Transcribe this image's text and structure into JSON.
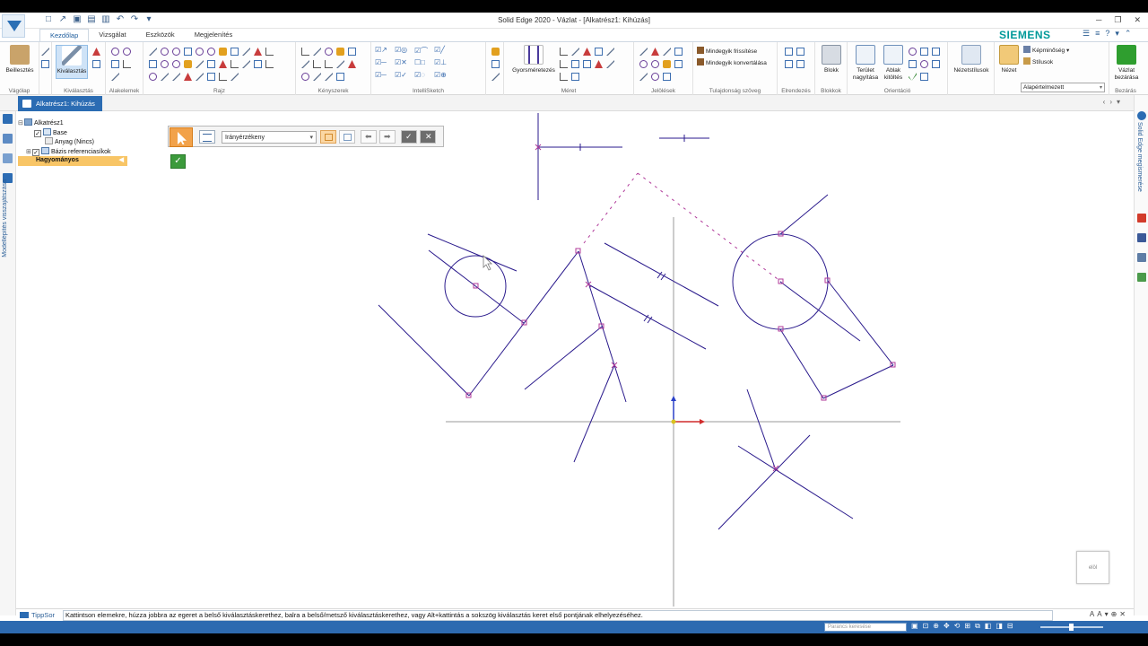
{
  "window": {
    "title": "Solid Edge 2020 - Vázlat - [Alkatrész1: Kihúzás]",
    "brand": "SIEMENS"
  },
  "ribbon_tabs": [
    "Kezdőlap",
    "Vizsgálat",
    "Eszközök",
    "Megjelenítés"
  ],
  "ribbon": {
    "clipboard": {
      "button": "Beillesztés",
      "group": "Vágólap"
    },
    "select": {
      "button": "Kiválasztás",
      "group": "Kiválasztás"
    },
    "features_group": "Alakelemek",
    "draw_group": "Rajz",
    "relations_group": "Kényszerek",
    "intellisketch_group": "IntelliSketch",
    "dimension": {
      "button": "Gyorsméretezés",
      "group": "Méret"
    },
    "annotation_group": "Jelölések",
    "property_text": {
      "item1": "Mindegyik frissítése",
      "item2": "Mindegyik konvertálása",
      "group": "Tulajdonság szöveg"
    },
    "arrange_group": "Elrendezés",
    "blocks": {
      "button": "Blokk",
      "group": "Blokkok"
    },
    "orient": {
      "fit_area": "Terület nagyítása",
      "fit_window": "Ablak kitöltés",
      "group": "Orientáció"
    },
    "views": {
      "button": "Nézetstílusok"
    },
    "style": {
      "view_button": "Nézet",
      "quality": "Képminőség",
      "styles": "Stílusok",
      "select_value": "Alapértelmezett",
      "group": "Stílus"
    },
    "close": {
      "button": "Vázlat bezárása",
      "group": "Bezárás"
    }
  },
  "doc_tab": "Alkatrész1: Kihúzás",
  "left_rail_text": "Modellépítés visszajátszása",
  "right_rail_text": "Solid Edge megismerése",
  "tree": {
    "root": "Alkatrész1",
    "items": [
      {
        "label": "Base",
        "checked": true
      },
      {
        "label": "Anyag (Nincs)"
      },
      {
        "label": "Bázis referenciasíkok",
        "checked": true
      },
      {
        "label": "Hagyományos"
      }
    ]
  },
  "command_bar": {
    "mode_value": "Irányérzékeny"
  },
  "viewcube_label": "elöl",
  "prompt": {
    "label": "TippSor",
    "text": "Kattintson elemekre, húzza jobbra az egeret a belső kiválasztáskerethez, balra a belső/metsző kiválasztáskerethez, vagy Alt+kattintás a sokszög kiválasztás keret első pontjának elhelyezéséhez."
  },
  "status": {
    "search_placeholder": "Parancs keresése"
  },
  "colors": {
    "sketch": "#2a1a8c",
    "handle": "#b03a9a",
    "accent": "#2b6cb3",
    "highlight": "#f8c566"
  }
}
